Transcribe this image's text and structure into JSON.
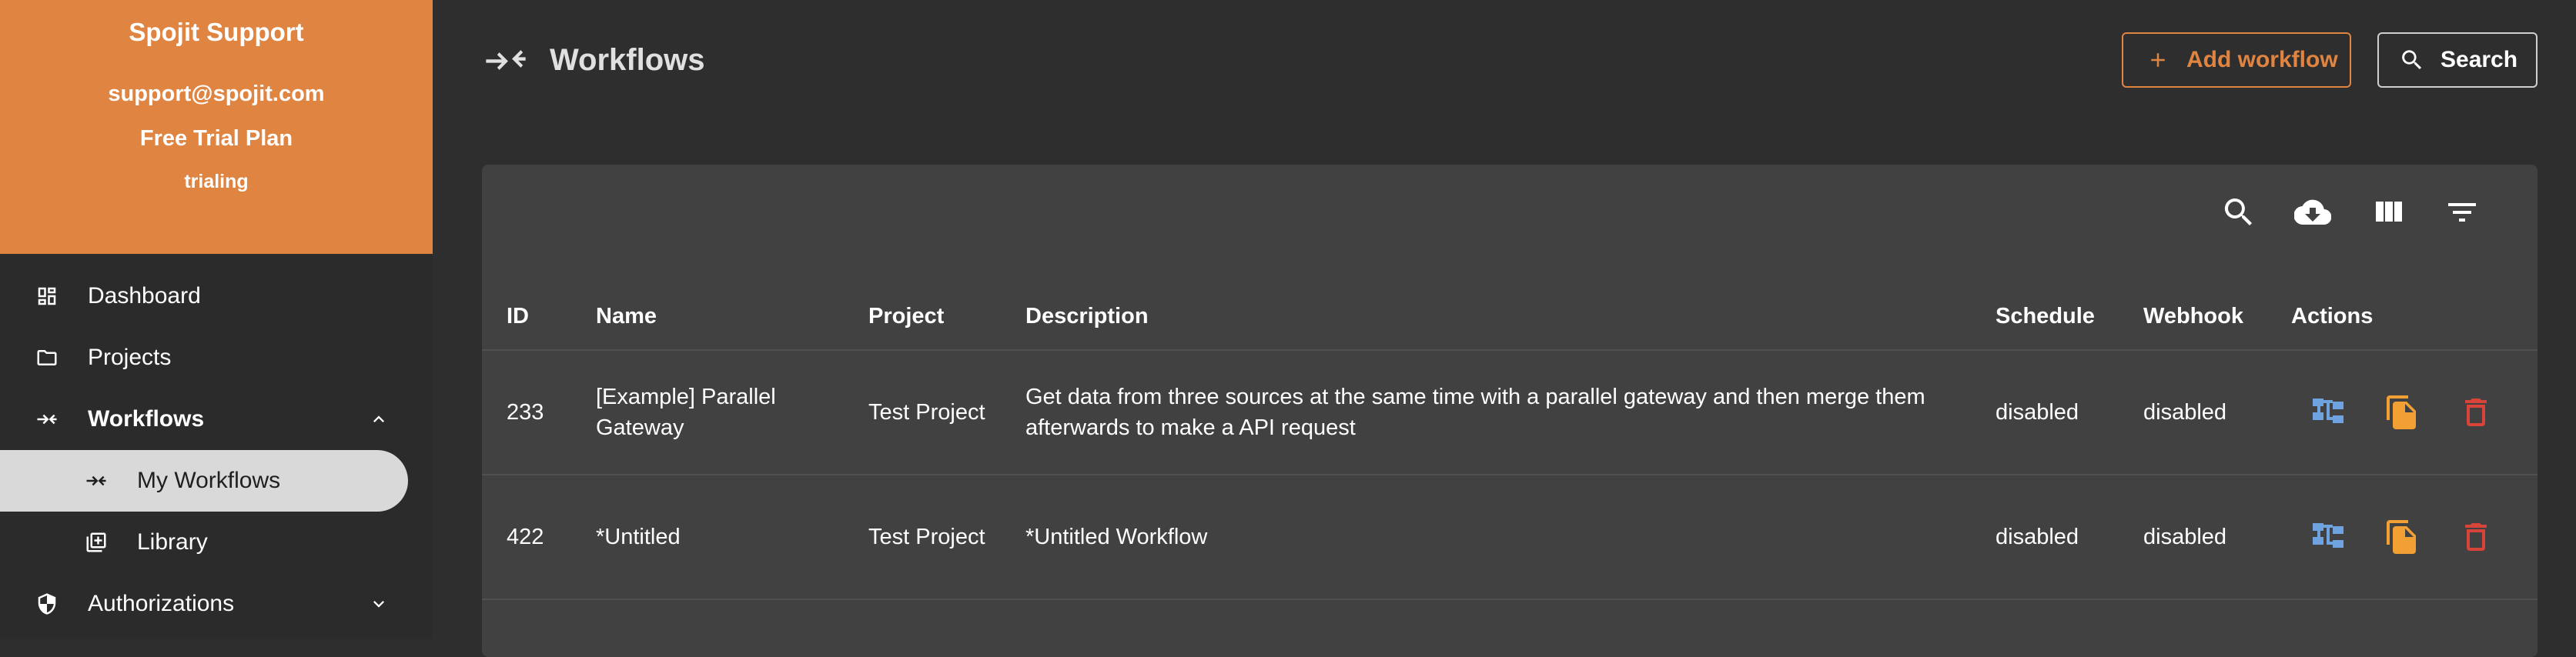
{
  "account": {
    "name": "Spojit Support",
    "email": "support@spojit.com",
    "plan": "Free Trial Plan",
    "status": "trialing"
  },
  "sidebar": {
    "items": [
      {
        "label": "Dashboard",
        "icon": "dashboard-icon"
      },
      {
        "label": "Projects",
        "icon": "folder-icon"
      },
      {
        "label": "Workflows",
        "icon": "workflow-icon",
        "expanded": true
      },
      {
        "label": "My Workflows",
        "icon": "workflow-icon",
        "selected": true
      },
      {
        "label": "Library",
        "icon": "library-icon"
      },
      {
        "label": "Authorizations",
        "icon": "shield-icon",
        "expanded": false
      }
    ]
  },
  "header": {
    "title": "Workflows",
    "add_label": "Add workflow",
    "search_label": "Search"
  },
  "table": {
    "columns": [
      "ID",
      "Name",
      "Project",
      "Description",
      "Schedule",
      "Webhook",
      "Actions"
    ],
    "rows": [
      {
        "id": "233",
        "name": "[Example] Parallel Gateway",
        "project": "Test Project",
        "description": "Get data from three sources at the same time with a parallel gateway and then merge them afterwards to make a API request",
        "schedule": "disabled",
        "webhook": "disabled"
      },
      {
        "id": "422",
        "name": "*Untitled",
        "project": "Test Project",
        "description": "*Untitled Workflow",
        "schedule": "disabled",
        "webhook": "disabled"
      }
    ]
  },
  "colors": {
    "accent": "#e08442",
    "background": "#2e2e2e",
    "panel": "#414141",
    "edit_icon": "#6fa3e0",
    "copy_icon": "#f2a033",
    "delete_icon": "#d9443a"
  }
}
